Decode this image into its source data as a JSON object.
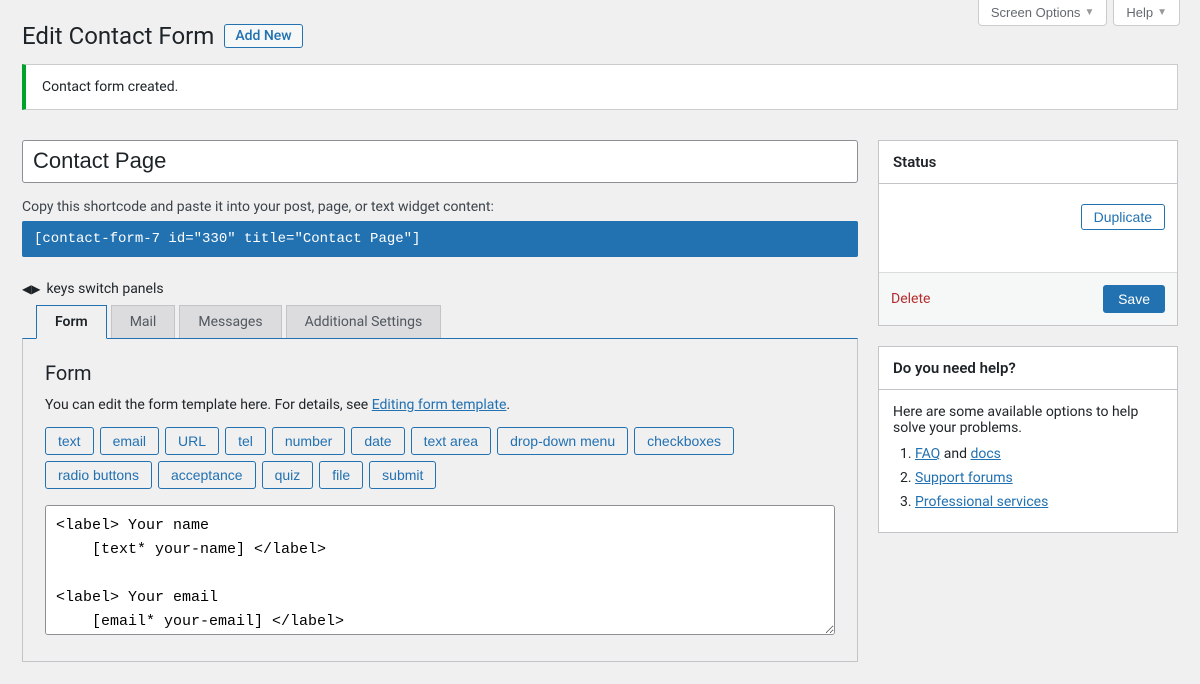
{
  "top": {
    "screen_options": "Screen Options",
    "help": "Help"
  },
  "header": {
    "title": "Edit Contact Form",
    "add_new": "Add New"
  },
  "notice": "Contact form created.",
  "form_title": "Contact Page",
  "shortcode_label": "Copy this shortcode and paste it into your post, page, or text widget content:",
  "shortcode": "[contact-form-7 id=\"330\" title=\"Contact Page\"]",
  "keys_hint": "keys switch panels",
  "tabs": {
    "form": "Form",
    "mail": "Mail",
    "messages": "Messages",
    "additional": "Additional Settings"
  },
  "panel": {
    "heading": "Form",
    "desc_prefix": "You can edit the form template here. For details, see ",
    "desc_link": "Editing form template",
    "desc_suffix": "."
  },
  "tags": [
    "text",
    "email",
    "URL",
    "tel",
    "number",
    "date",
    "text area",
    "drop-down menu",
    "checkboxes",
    "radio buttons",
    "acceptance",
    "quiz",
    "file",
    "submit"
  ],
  "form_template": "<label> Your name\n    [text* your-name] </label>\n\n<label> Your email\n    [email* your-email] </label>",
  "status": {
    "title": "Status",
    "duplicate": "Duplicate",
    "delete": "Delete",
    "save": "Save"
  },
  "help_box": {
    "title": "Do you need help?",
    "intro": "Here are some available options to help solve your problems.",
    "item1_link": "FAQ",
    "item1_mid": " and ",
    "item1_link2": "docs",
    "item2": "Support forums",
    "item3": "Professional services"
  }
}
